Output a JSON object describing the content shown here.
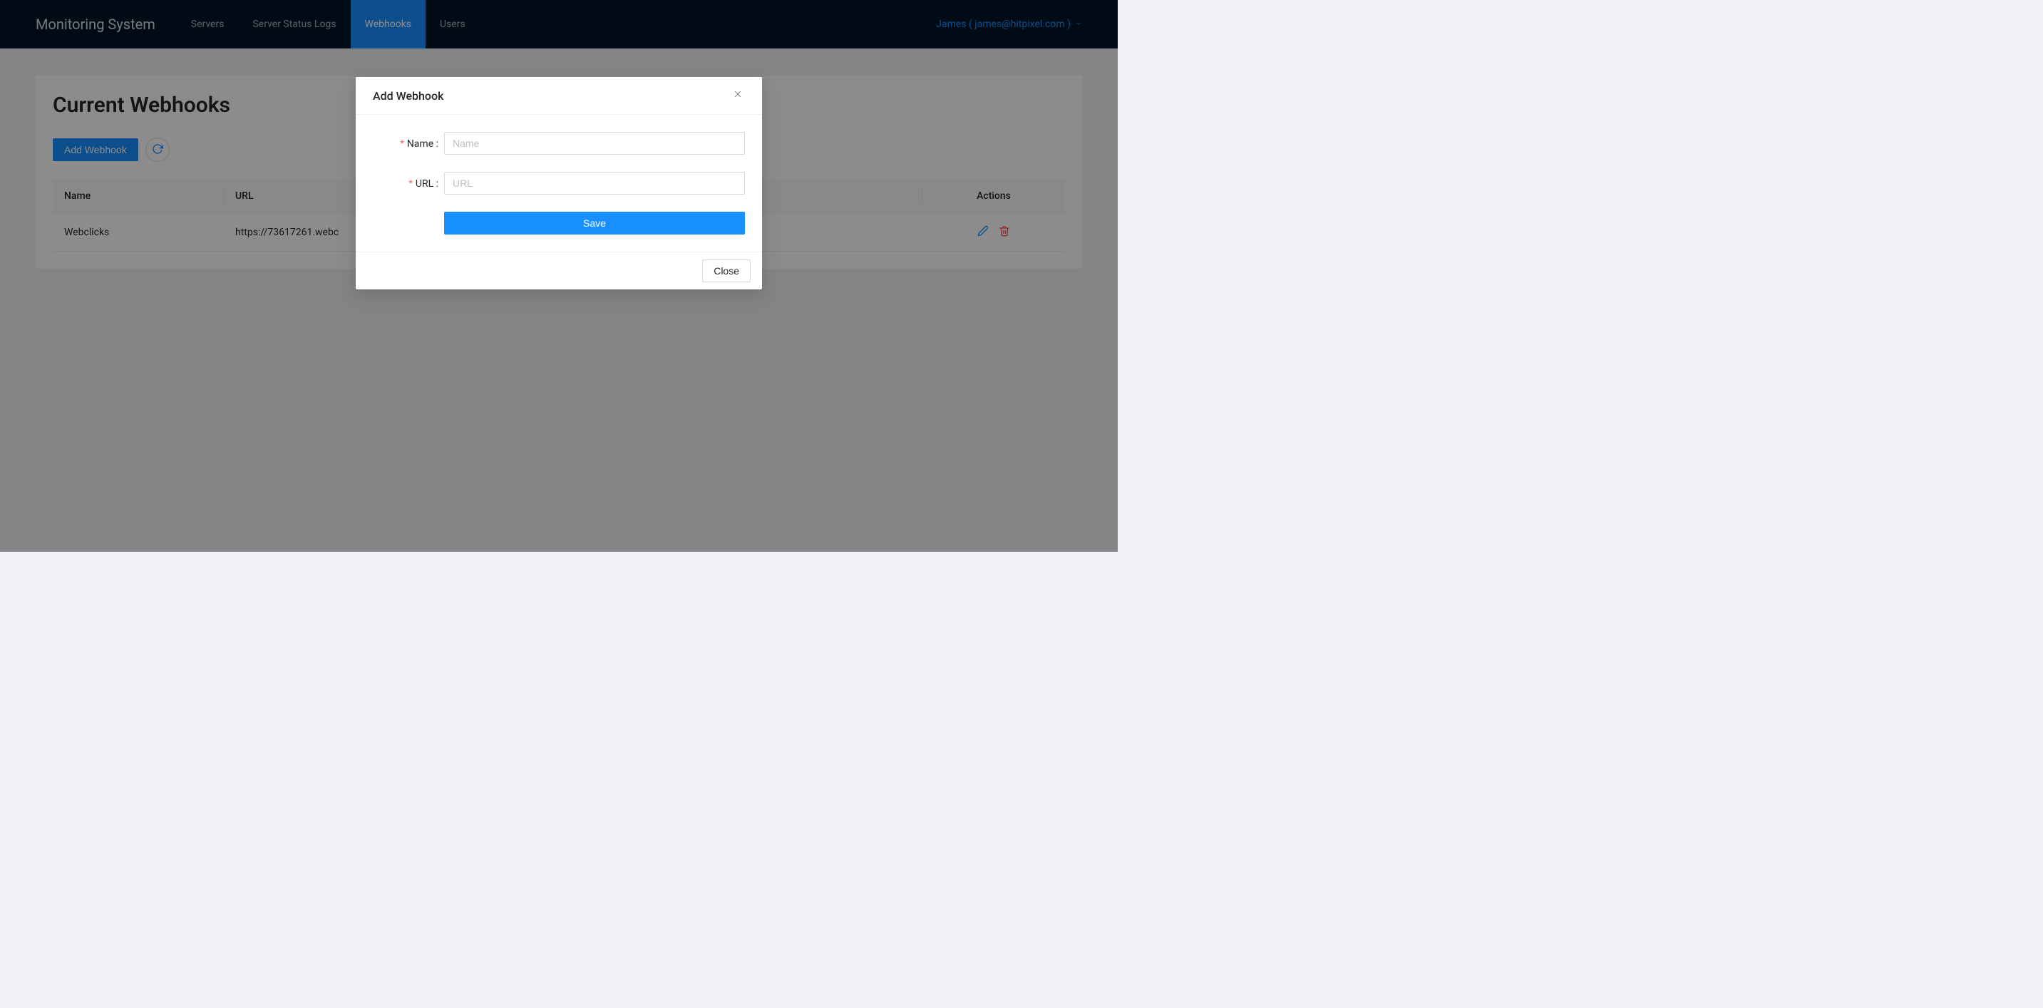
{
  "navbar": {
    "brand": "Monitoring System",
    "items": [
      {
        "label": "Servers",
        "active": false
      },
      {
        "label": "Server Status Logs",
        "active": false
      },
      {
        "label": "Webhooks",
        "active": true
      },
      {
        "label": "Users",
        "active": false
      }
    ],
    "user_label": "James ( james@hitpixel.com )"
  },
  "page": {
    "title": "Current Webhooks",
    "add_button": "Add Webhook"
  },
  "table": {
    "headers": {
      "name": "Name",
      "url": "URL",
      "actions": "Actions"
    },
    "rows": [
      {
        "name": "Webclicks",
        "url": "https://73617261.webc"
      }
    ]
  },
  "modal": {
    "title": "Add Webhook",
    "fields": {
      "name_label": "Name",
      "name_placeholder": "Name",
      "url_label": "URL",
      "url_placeholder": "URL"
    },
    "save_label": "Save",
    "close_label": "Close"
  }
}
